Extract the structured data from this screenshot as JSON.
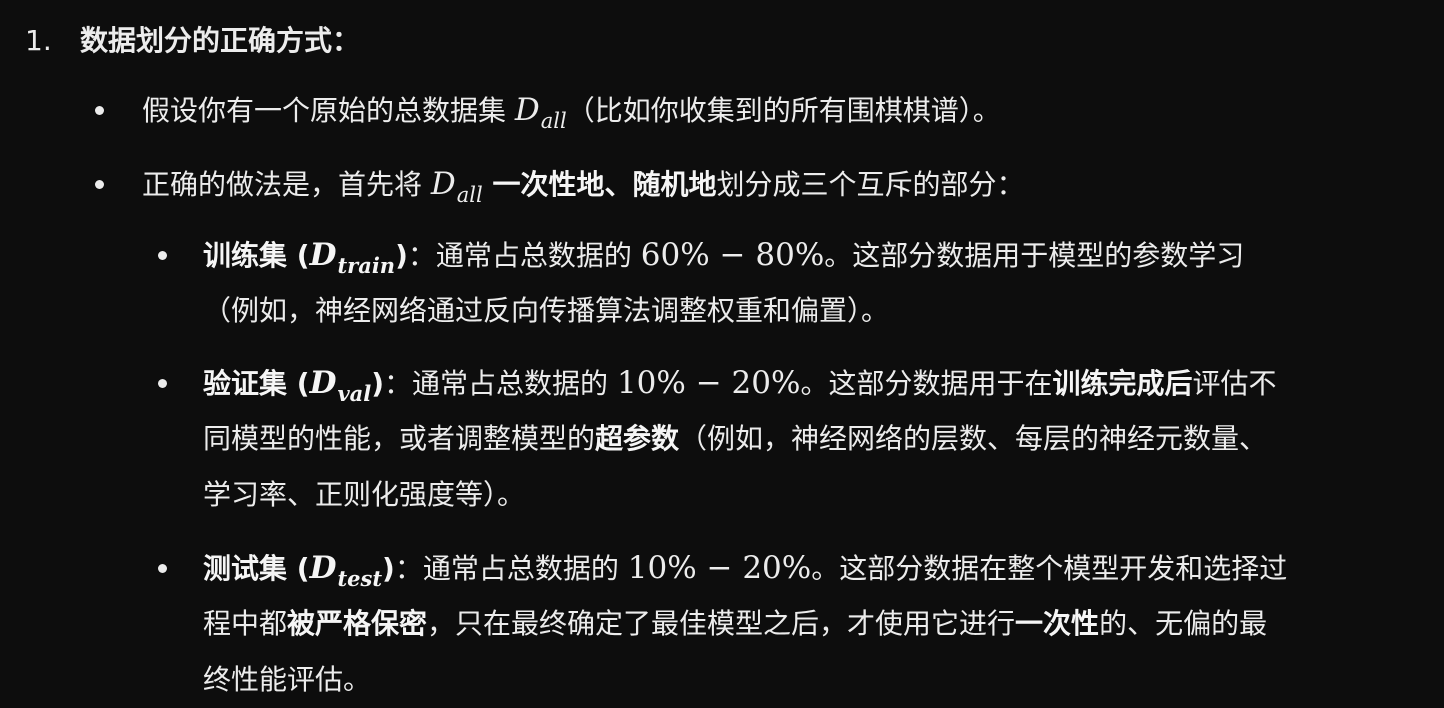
{
  "list": {
    "number": "1.",
    "title": "数据划分的正确方式："
  },
  "bullets": [
    {
      "before": "假设你有一个原始的总数据集 ",
      "math_main": "D",
      "math_sub": "all",
      "after": "（比如你收集到的所有围棋棋谱）。"
    },
    {
      "before": "正确的做法是，首先将 ",
      "math_main": "D",
      "math_sub": "all",
      "bold": " 一次性地、随机地",
      "after": "划分成三个互斥的部分："
    }
  ],
  "subsets": [
    {
      "name": "训练集",
      "open": " (",
      "math_main": "D",
      "math_sub": "train",
      "close": ")",
      "colon": "：通常占总数据的 ",
      "range": "60% − 80%",
      "line1_end": "。这部分数据用于模型的参数学习",
      "line2": "（例如，神经网络通过反向传播算法调整权重和偏置）。"
    },
    {
      "name": "验证集",
      "open": " (",
      "math_main": "D",
      "math_sub": "val",
      "close": ")",
      "colon": "：通常占总数据的 ",
      "range": "10% − 20%",
      "line1_mid": "。这部分数据用于在",
      "line1_bold": "训练完成后",
      "line1_end": "评估不",
      "line2_start": "同模型的性能，或者调整模型的",
      "line2_bold": "超参数",
      "line2_end": "（例如，神经网络的层数、每层的神经元数量、",
      "line3": "学习率、正则化强度等）。"
    },
    {
      "name": "测试集",
      "open": " (",
      "math_main": "D",
      "math_sub": "test",
      "close": ")",
      "colon": "：通常占总数据的 ",
      "range": "10% − 20%",
      "line1_end": "。这部分数据在整个模型开发和选择过",
      "line2_start": "程中都",
      "line2_bold": "被严格保密",
      "line2_mid": "，只在最终确定了最佳模型之后，才使用它进行",
      "line2_bold2": "一次性",
      "line2_end": "的、无偏的最",
      "line3": "终性能评估。"
    }
  ]
}
